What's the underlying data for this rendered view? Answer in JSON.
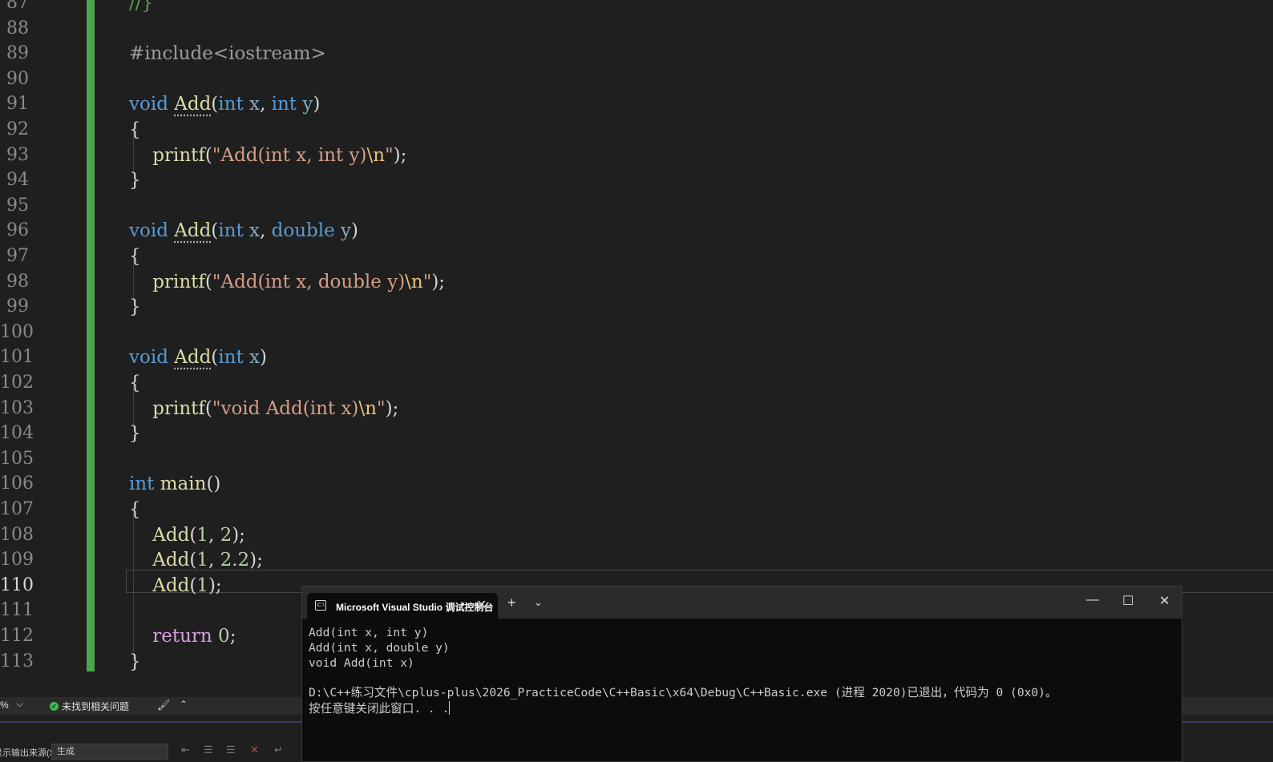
{
  "editor": {
    "line_numbers": [
      "87",
      "88",
      "89",
      "90",
      "91",
      "92",
      "93",
      "94",
      "95",
      "96",
      "97",
      "98",
      "99",
      "100",
      "101",
      "102",
      "103",
      "104",
      "105",
      "106",
      "107",
      "108",
      "109",
      "110",
      "111",
      "112",
      "113"
    ],
    "current_line": "110",
    "code": {
      "l87": "//}",
      "include": "#include<iostream>",
      "void": "void",
      "int": "int",
      "double": "double",
      "add": "Add",
      "printf": "printf",
      "main": "main",
      "return": "return",
      "zero": "0",
      "s1": "\"Add(int x, int y)",
      "s2": "\"Add(int x, double y)",
      "s3": "\"void Add(int x)",
      "esc": "\\n",
      "q": "\"",
      "one": "1",
      "two": "2",
      "twopt": "2.2",
      "x": "x",
      "y": "y"
    }
  },
  "status": {
    "zoom": "%",
    "issues": "未找到相关问题"
  },
  "output": {
    "source_label": "显示输出来源(S):",
    "source_value": "生成"
  },
  "console": {
    "tab_title": "Microsoft Visual Studio 调试控制台",
    "lines": [
      "Add(int x, int y)",
      "Add(int x, double y)",
      "void Add(int x)",
      "",
      "D:\\C++练习文件\\cplus-plus\\2026_PracticeCode\\C++Basic\\x64\\Debug\\C++Basic.exe (进程 2020)已退出，代码为 0 (0x0)。",
      "按任意键关闭此窗口. . ."
    ]
  },
  "colors": {
    "keyword": "#569cd6",
    "function": "#dcdcaa",
    "string": "#d69d85",
    "escape": "#e8c27a",
    "number": "#b5cea8",
    "control": "#d8a0df",
    "change_bar": "#4ca64c"
  }
}
